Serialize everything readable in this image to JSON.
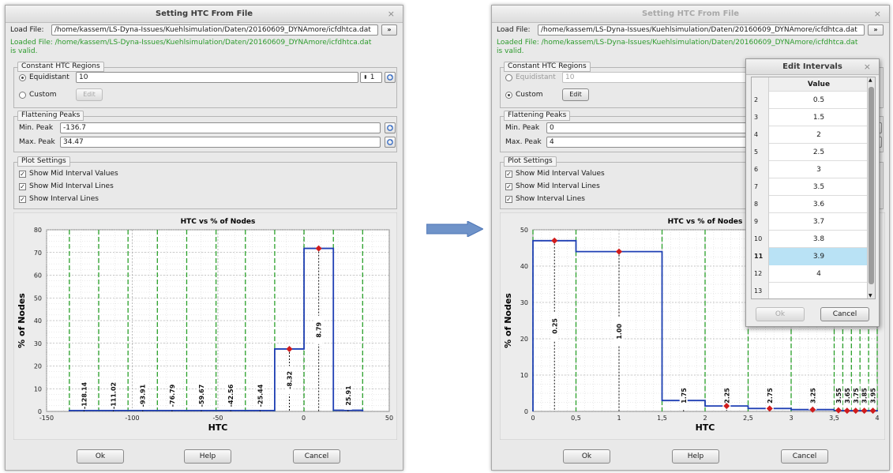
{
  "left": {
    "title": "Setting HTC From File",
    "load_file_label": "Load File:",
    "load_file_value": "/home/kassem/LS-Dyna-Issues/Kuehlsimulation/Daten/20160609_DYNAmore/icfdhtca.dat",
    "browse_label": "»",
    "loaded_line1": "Loaded File: /home/kassem/LS-Dyna-Issues/Kuehlsimulation/Daten/20160609_DYNAmore/icfdhtca.dat",
    "loaded_line2": "is valid.",
    "constant_group": "Constant HTC Regions",
    "equidistant_label": "Equidistant",
    "equidistant_value": "10",
    "spin_value": "1",
    "custom_label": "Custom",
    "edit_label": "Edit",
    "flatten_group": "Flattening Peaks",
    "min_peak_label": "Min. Peak",
    "min_peak_value": "-136.7",
    "max_peak_label": "Max. Peak",
    "max_peak_value": "34.47",
    "plot_group": "Plot Settings",
    "chk1": "Show Mid Interval Values",
    "chk2": "Show Mid Interval Lines",
    "chk3": "Show Interval Lines",
    "ok": "Ok",
    "help": "Help",
    "cancel": "Cancel"
  },
  "right": {
    "title": "Setting HTC From File",
    "load_file_label": "Load File:",
    "load_file_value": "/home/kassem/LS-Dyna-Issues/Kuehlsimulation/Daten/20160609_DYNAmore/icfdhtca.dat",
    "browse_label": "»",
    "loaded_line1": "Loaded File: /home/kassem/LS-Dyna-Issues/Kuehlsimulation/Daten/20160609_DYNAmore/icfdhtca.dat",
    "loaded_line2": "is valid.",
    "constant_group": "Constant HTC Regions",
    "equidistant_label": "Equidistant",
    "equidistant_value": "10",
    "custom_label": "Custom",
    "edit_label": "Edit",
    "flatten_group": "Flattening Peaks",
    "min_peak_label": "Min. Peak",
    "min_peak_value": "0",
    "max_peak_label": "Max. Peak",
    "max_peak_value": "4",
    "plot_group": "Plot Settings",
    "chk1": "Show Mid Interval Values",
    "chk2": "Show Mid Interval Lines",
    "chk3": "Show Interval Lines",
    "ok": "Ok",
    "help": "Help",
    "cancel": "Cancel"
  },
  "popup": {
    "title": "Edit Intervals",
    "column_header": "Value",
    "rows": [
      {
        "idx": "2",
        "value": "0.5"
      },
      {
        "idx": "3",
        "value": "1.5"
      },
      {
        "idx": "4",
        "value": "2"
      },
      {
        "idx": "5",
        "value": "2.5"
      },
      {
        "idx": "6",
        "value": "3"
      },
      {
        "idx": "7",
        "value": "3.5"
      },
      {
        "idx": "8",
        "value": "3.6"
      },
      {
        "idx": "9",
        "value": "3.7"
      },
      {
        "idx": "10",
        "value": "3.8"
      },
      {
        "idx": "11",
        "value": "3.9"
      },
      {
        "idx": "12",
        "value": "4"
      },
      {
        "idx": "13",
        "value": ""
      }
    ],
    "selected_idx": "11",
    "ok": "Ok",
    "cancel": "Cancel"
  },
  "colors": {
    "step_line": "#1f3fb4",
    "interval_line": "#2aa02a",
    "peak_marker": "#d01c1c",
    "arrow": "#6f93c9"
  },
  "chart_data": [
    {
      "type": "line",
      "title": "HTC vs % of Nodes",
      "xlabel": "HTC",
      "ylabel": "% of Nodes",
      "xlim": [
        -150,
        50
      ],
      "ylim": [
        0,
        80
      ],
      "xticks": [
        "-150",
        "-100",
        "-50",
        "0",
        "50"
      ],
      "yticks": [
        "0",
        "10",
        "20",
        "30",
        "40",
        "50",
        "60",
        "70",
        "80"
      ],
      "boundaries": [
        -136.7,
        -119.58,
        -102.46,
        -85.34,
        -68.22,
        -51.1,
        -33.98,
        -16.86,
        0.26,
        17.38,
        34.47
      ],
      "values": [
        0.4,
        0.4,
        0.4,
        0.4,
        0.4,
        0.4,
        0.4,
        27.5,
        71.8,
        0.5
      ],
      "mid_labels": [
        "-128.14",
        "-111.02",
        "-93.91",
        "-76.79",
        "-59.67",
        "-42.56",
        "-25.44",
        "-8.32",
        "8.79",
        "25.91"
      ],
      "peaks": [
        7,
        8
      ],
      "grid": true
    },
    {
      "type": "line",
      "title": "HTC vs % of Nodes",
      "xlabel": "HTC",
      "ylabel": "% of Nodes",
      "xlim": [
        0,
        4
      ],
      "ylim": [
        0,
        50
      ],
      "xticks": [
        "0",
        "0,5",
        "1",
        "1,5",
        "2",
        "2,5",
        "3",
        "3,5",
        "4"
      ],
      "yticks": [
        "0",
        "10",
        "20",
        "30",
        "40",
        "50"
      ],
      "boundaries": [
        0,
        0.5,
        1.5,
        2,
        2.5,
        3,
        3.5,
        3.6,
        3.7,
        3.8,
        3.9,
        4
      ],
      "values": [
        47,
        44,
        3,
        1.5,
        0.8,
        0.5,
        0.3,
        0.2,
        0.2,
        0.2,
        0.2
      ],
      "mid_labels": [
        "0.25",
        "1.00",
        "1.75",
        "2.25",
        "2.75",
        "3.25",
        "3.55",
        "3.65",
        "3.75",
        "3.85",
        "3.95"
      ],
      "peaks": [
        0,
        1,
        3,
        4,
        5,
        6,
        7,
        8,
        9,
        10
      ],
      "grid": true
    }
  ]
}
